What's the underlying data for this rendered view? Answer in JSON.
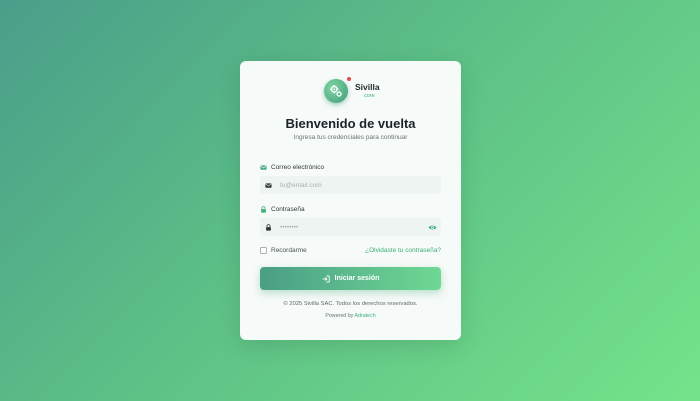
{
  "brand": {
    "name": "Sivilla",
    "sub": "core"
  },
  "title": "Bienvenido de vuelta",
  "subtitle": "Ingresa tus credenciales para continuar",
  "email": {
    "label": "Correo electrónico",
    "placeholder": "tu@email.com",
    "value": "",
    "icon": "envelope-icon"
  },
  "password": {
    "label": "Contraseña",
    "placeholder": "••••••••",
    "value": "",
    "icon": "lock-icon",
    "toggle_icon": "eye-icon"
  },
  "remember": {
    "label": "Recordarme",
    "checked": false
  },
  "forgot": {
    "label": "¿Olvidaste tu contraseña?"
  },
  "submit": {
    "label": "Iniciar sesión",
    "icon": "sign-in-icon"
  },
  "footer": {
    "copyright": "© 2025 Sivilla SAC. Todos los derechos reservados.",
    "powered_prefix": "Powered by",
    "powered_link": "Adratech"
  },
  "colors": {
    "accent": "#3fae7a",
    "background_start": "#4a9e8a",
    "background_end": "#74e38a",
    "card": "#f6faf8",
    "button_start": "#4a9e85",
    "button_end": "#6fd894"
  }
}
